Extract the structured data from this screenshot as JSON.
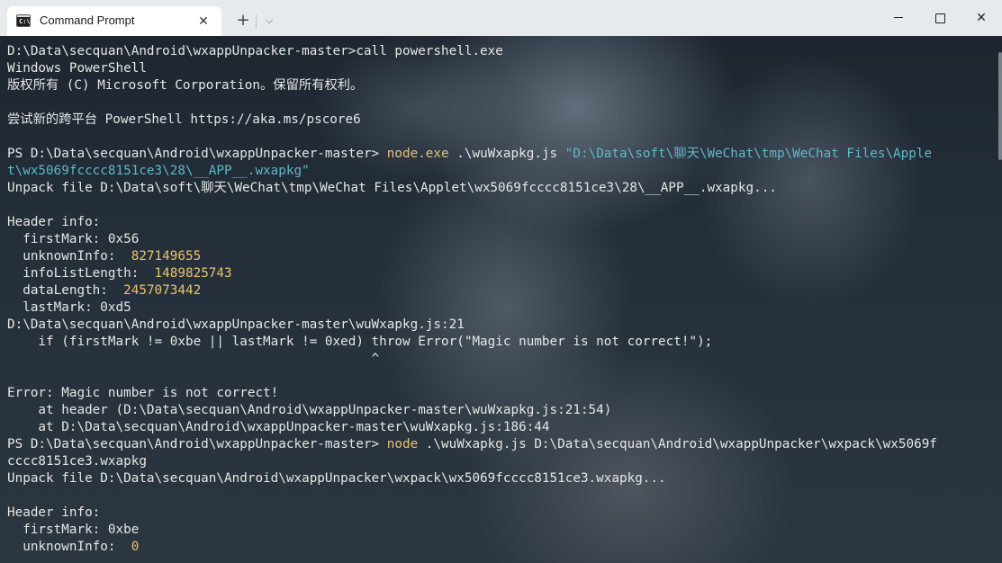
{
  "titlebar": {
    "tab_icon_text": "C:\\",
    "tab_title": "Command Prompt",
    "close_tab_symbol": "✕",
    "new_tab_symbol": "+",
    "dropdown_symbol": "⌵",
    "close_window_symbol": "✕"
  },
  "terminal": {
    "lines": [
      [
        {
          "text": "D:\\Data\\secquan\\Android\\wxappUnpacker-master>call powershell.exe"
        }
      ],
      [
        {
          "text": "Windows PowerShell"
        }
      ],
      [
        {
          "text": "版权所有 (C) Microsoft Corporation。保留所有权利。"
        }
      ],
      [
        {
          "text": ""
        }
      ],
      [
        {
          "text": "尝试新的跨平台 PowerShell https://aka.ms/pscore6"
        }
      ],
      [
        {
          "text": ""
        }
      ],
      [
        {
          "text": "PS D:\\Data\\secquan\\Android\\wxappUnpacker-master> "
        },
        {
          "text": "node.exe",
          "color": "yellow"
        },
        {
          "text": " .\\wuWxapkg.js "
        },
        {
          "text": "\"D:\\Data\\soft\\聊天\\WeChat\\tmp\\WeChat Files\\Apple",
          "color": "cyan"
        }
      ],
      [
        {
          "text": "t\\wx5069fcccc8151ce3\\28\\__APP__.wxapkg\"",
          "color": "cyan"
        }
      ],
      [
        {
          "text": "Unpack file D:\\Data\\soft\\聊天\\WeChat\\tmp\\WeChat Files\\Applet\\wx5069fcccc8151ce3\\28\\__APP__.wxapkg..."
        }
      ],
      [
        {
          "text": ""
        }
      ],
      [
        {
          "text": "Header info:"
        }
      ],
      [
        {
          "text": "  firstMark: 0x56"
        }
      ],
      [
        {
          "text": "  unknownInfo:  "
        },
        {
          "text": "827149655",
          "color": "num"
        }
      ],
      [
        {
          "text": "  infoListLength:  "
        },
        {
          "text": "1489825743",
          "color": "num"
        }
      ],
      [
        {
          "text": "  dataLength:  "
        },
        {
          "text": "2457073442",
          "color": "num"
        }
      ],
      [
        {
          "text": "  lastMark: 0xd5"
        }
      ],
      [
        {
          "text": "D:\\Data\\secquan\\Android\\wxappUnpacker-master\\wuWxapkg.js:21"
        }
      ],
      [
        {
          "text": "    if (firstMark != 0xbe || lastMark != 0xed) throw Error(\"Magic number is not correct!\");"
        }
      ],
      [
        {
          "text": "                                               ^"
        }
      ],
      [
        {
          "text": ""
        }
      ],
      [
        {
          "text": "Error: Magic number is not correct!"
        }
      ],
      [
        {
          "text": "    at header (D:\\Data\\secquan\\Android\\wxappUnpacker-master\\wuWxapkg.js:21:54)"
        }
      ],
      [
        {
          "text": "    at D:\\Data\\secquan\\Android\\wxappUnpacker-master\\wuWxapkg.js:186:44"
        }
      ],
      [
        {
          "text": "PS D:\\Data\\secquan\\Android\\wxappUnpacker-master> "
        },
        {
          "text": "node",
          "color": "yellow"
        },
        {
          "text": " .\\wuWxapkg.js D:\\Data\\secquan\\Android\\wxappUnpacker\\wxpack\\wx5069f"
        }
      ],
      [
        {
          "text": "cccc8151ce3.wxapkg"
        }
      ],
      [
        {
          "text": "Unpack file D:\\Data\\secquan\\Android\\wxappUnpacker\\wxpack\\wx5069fcccc8151ce3.wxapkg..."
        }
      ],
      [
        {
          "text": ""
        }
      ],
      [
        {
          "text": "Header info:"
        }
      ],
      [
        {
          "text": "  firstMark: 0xbe"
        }
      ],
      [
        {
          "text": "  unknownInfo:  "
        },
        {
          "text": "0",
          "color": "num"
        }
      ]
    ]
  },
  "colors": {
    "text": "#e6e6e6",
    "yellow": "#e5c07b",
    "cyan": "#5fb8c8",
    "num": "#e9c46a",
    "titlebar": "#e7eaed"
  }
}
